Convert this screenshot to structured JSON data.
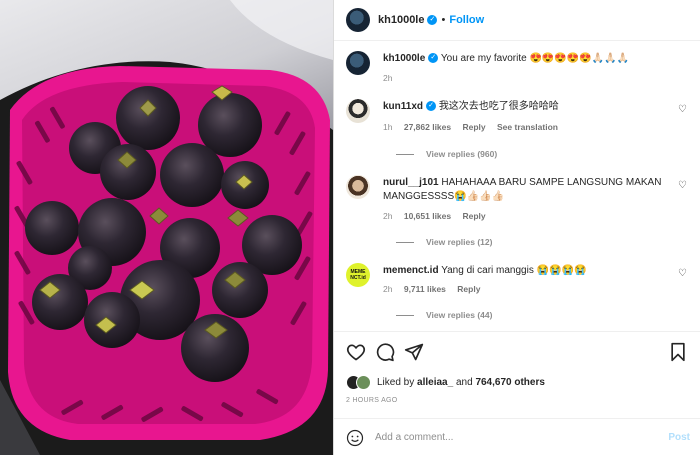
{
  "post": {
    "author": "kh1000le",
    "follow_label": "Follow",
    "separator": "•",
    "image_alt": "pink plastic basket of mangosteens"
  },
  "caption": {
    "username": "kh1000le",
    "text": "You are my favorite 😍😍😍😍😍🙏🏻🙏🏻🙏🏻",
    "age": "2h"
  },
  "comments": [
    {
      "username": "kun11xd",
      "verified": true,
      "text": "我这次去也吃了很多哈哈哈",
      "age": "1h",
      "likes": "27,862 likes",
      "reply": "Reply",
      "extra": "See translation",
      "view_replies": "View replies (960)"
    },
    {
      "username": "nurul__j101",
      "verified": false,
      "text": "HAHAHAAA BARU SAMPE LANGSUNG MAKAN MANGGESSSS😭👍🏻👍🏻👍🏻",
      "age": "2h",
      "likes": "10,651 likes",
      "reply": "Reply",
      "view_replies": "View replies (12)"
    },
    {
      "username": "memenct.id",
      "verified": false,
      "text": "Yang di cari manggis 😭😭😭😭",
      "age": "2h",
      "likes": "9,711 likes",
      "reply": "Reply",
      "view_replies": "View replies (44)",
      "avatar_text": "MEME NCT.id"
    }
  ],
  "engagement": {
    "liked_by_prefix": "Liked by",
    "liked_by_user": "alleiaa_",
    "and": "and",
    "others_count": "764,670 others",
    "timestamp": "2 HOURS AGO"
  },
  "add_comment": {
    "placeholder": "Add a comment...",
    "post_label": "Post"
  },
  "icons": [
    "heart-icon",
    "comment-icon",
    "share-icon",
    "bookmark-icon",
    "smile-icon",
    "verified-icon"
  ],
  "colors": {
    "accent": "#0095f6",
    "basket": "#e8168f",
    "fruit": "#2a2430",
    "post_disabled": "#b2dffc"
  }
}
